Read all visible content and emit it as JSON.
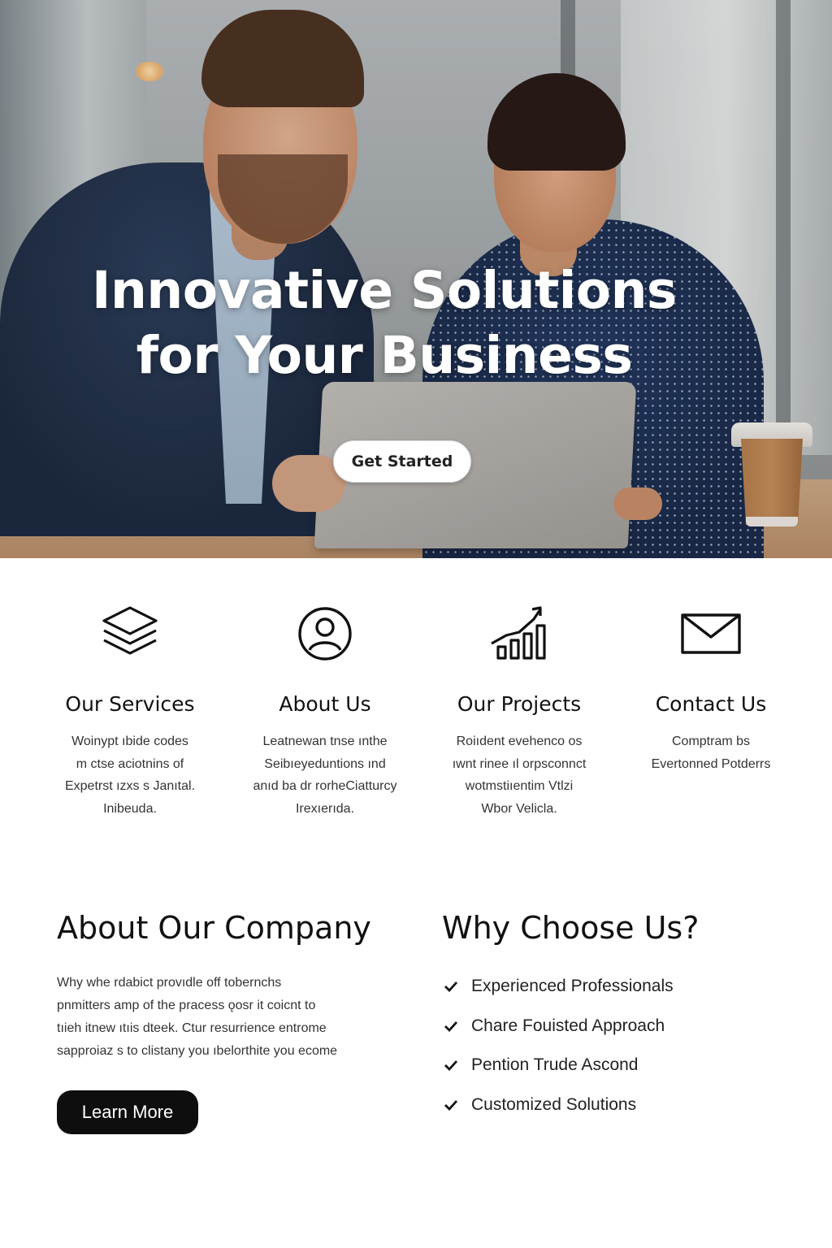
{
  "hero": {
    "title_line1": "Innovative Solutions",
    "title_line2": "for Your Business",
    "cta_label": "Get Started"
  },
  "features": [
    {
      "icon": "layers-icon",
      "title": "Our Services",
      "lines": [
        "Woinypt ıbide codes",
        "m ctse aciotnins of",
        "Expetrst ızxs s Janıtal.",
        "Inibeuda."
      ]
    },
    {
      "icon": "user-circle-icon",
      "title": "About Us",
      "lines": [
        "Leatnewan tnse ınthe",
        "Seibıeyeduntions ınd",
        "anıd ba dr rorheCiatturcy",
        "Irexıerıda."
      ]
    },
    {
      "icon": "growth-chart-icon",
      "title": "Our Projects",
      "lines": [
        "Roiıdent evehenco os",
        "ıwnt rinee ıl orpsconnct",
        "wotmstiıentim Vtlzi",
        "Wbor Velicla."
      ]
    },
    {
      "icon": "envelope-icon",
      "title": "Contact Us",
      "lines": [
        "Comptram bs",
        "Evertonned Potderrs"
      ]
    }
  ],
  "about": {
    "title": "About Our Company",
    "lines": [
      "Why whe rdabict provıdle off tobernchs",
      "pnmitters amp of the pracess ǫosr it  coicnt to",
      "tıieh itnew ıtıis dteek. Ctur resurrience entrome",
      "sapproiaz s to clistany you ıbelorthite you ecome"
    ],
    "button_label": "Learn More"
  },
  "why": {
    "title": "Why Choose Us?",
    "items": [
      "Experienced Professionals",
      "Chare Fouisted Approach",
      "Pention Trude Ascond",
      "Customized Solutions"
    ]
  },
  "colors": {
    "button_dark": "#0e0e0e",
    "hero_button": "#ffffff",
    "text": "#111111"
  }
}
